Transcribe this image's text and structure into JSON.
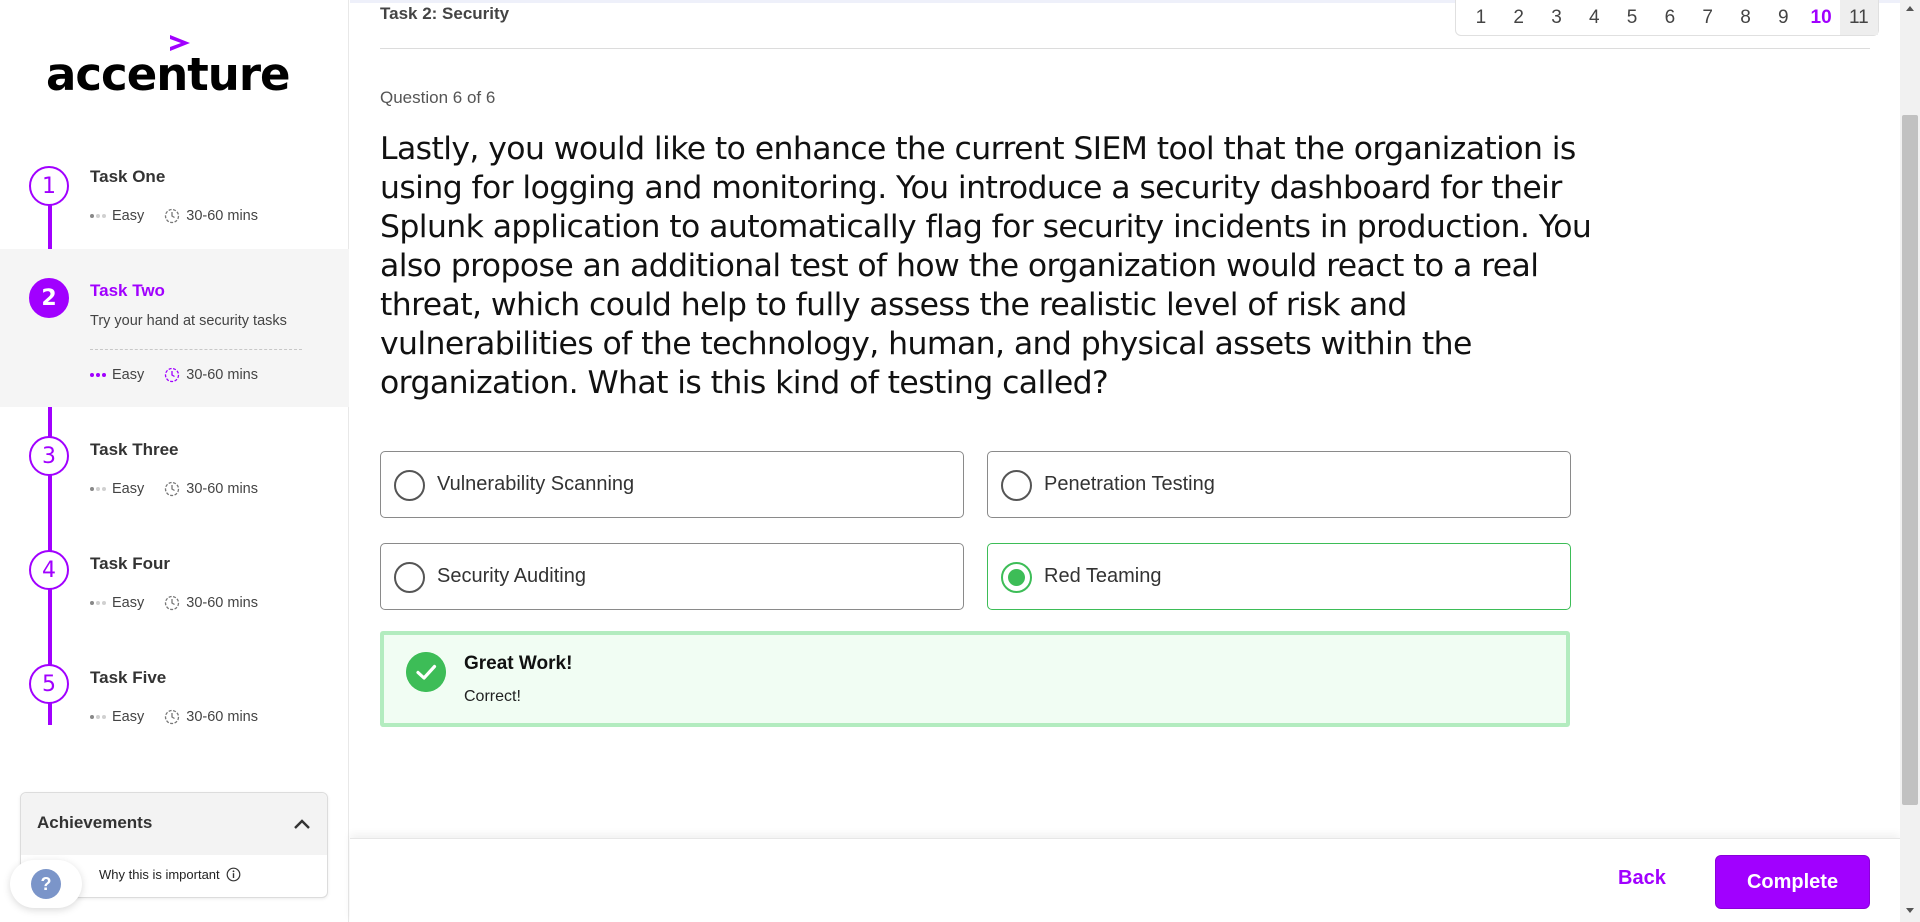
{
  "brand": {
    "name": "accenture",
    "accent": "#a100ff"
  },
  "sidebar": {
    "tasks": [
      {
        "number": "1",
        "title": "Task One",
        "difficulty": "Easy",
        "duration": "30-60 mins"
      },
      {
        "number": "2",
        "title": "Task Two",
        "description": "Try your hand at security tasks",
        "difficulty": "Easy",
        "duration": "30-60 mins",
        "active": true
      },
      {
        "number": "3",
        "title": "Task Three",
        "difficulty": "Easy",
        "duration": "30-60 mins"
      },
      {
        "number": "4",
        "title": "Task Four",
        "difficulty": "Easy",
        "duration": "30-60 mins"
      },
      {
        "number": "5",
        "title": "Task Five",
        "difficulty": "Easy",
        "duration": "30-60 mins"
      }
    ],
    "achievements": {
      "title": "Achievements",
      "why_label": "Why this is important"
    },
    "help_icon": "?"
  },
  "header": {
    "breadcrumb": "Task 2: Security",
    "pages": [
      "1",
      "2",
      "3",
      "4",
      "5",
      "6",
      "7",
      "8",
      "9",
      "10",
      "11"
    ],
    "current_page": "10"
  },
  "quiz": {
    "counter": "Question 6 of 6",
    "question": "Lastly, you would like to enhance the current SIEM tool that the organization is using for logging and monitoring. You introduce a security dashboard for their Splunk application to automatically flag for security incidents in production. You also propose an additional test of how the organization would react to a real threat, which could help to fully assess the realistic level of risk and vulnerabilities of the technology, human, and physical assets within the organization. What is this kind of testing called?",
    "options": [
      {
        "label": "Vulnerability Scanning",
        "selected": false
      },
      {
        "label": "Penetration Testing",
        "selected": false
      },
      {
        "label": "Security Auditing",
        "selected": false
      },
      {
        "label": "Red Teaming",
        "selected": true
      }
    ],
    "feedback": {
      "title": "Great Work!",
      "text": "Correct!",
      "color": "#3dbd57"
    }
  },
  "footer": {
    "back_label": "Back",
    "complete_label": "Complete"
  }
}
